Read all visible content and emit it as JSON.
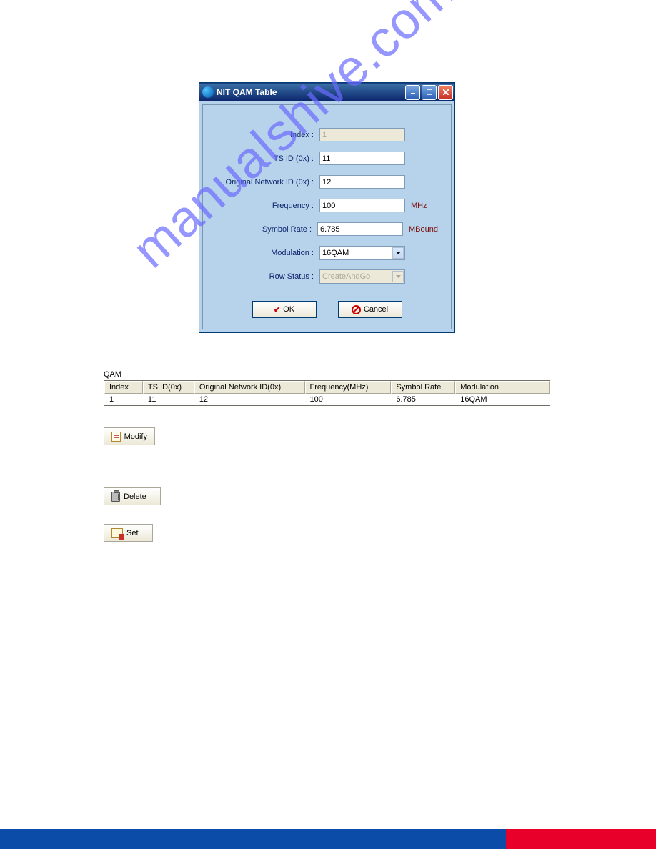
{
  "dialog": {
    "title": "NIT QAM Table",
    "labels": {
      "index": "Index :",
      "tsid": "TS ID (0x) :",
      "onid": "Original Network ID (0x) :",
      "freq": "Frequency :",
      "symrate": "Symbol Rate :",
      "modulation": "Modulation :",
      "rowstatus": "Row Status :"
    },
    "values": {
      "index": "1",
      "tsid": "11",
      "onid": "12",
      "freq": "100",
      "symrate": "6.785",
      "modulation": "16QAM",
      "rowstatus": "CreateAndGo"
    },
    "units": {
      "freq": "MHz",
      "symrate": "MBound"
    },
    "buttons": {
      "ok": "OK",
      "cancel": "Cancel"
    }
  },
  "table": {
    "group_label": "QAM",
    "headers": {
      "index": "Index",
      "tsid": "TS ID(0x)",
      "onid": "Original Network ID(0x)",
      "freq": "Frequency(MHz)",
      "symrate": "Symbol Rate",
      "modulation": "Modulation"
    },
    "row": {
      "index": "1",
      "tsid": "11",
      "onid": "12",
      "freq": "100",
      "symrate": "6.785",
      "modulation": "16QAM"
    }
  },
  "actions": {
    "modify": "Modify",
    "delete": "Delete",
    "set": "Set"
  },
  "watermark": "manualshive.com"
}
